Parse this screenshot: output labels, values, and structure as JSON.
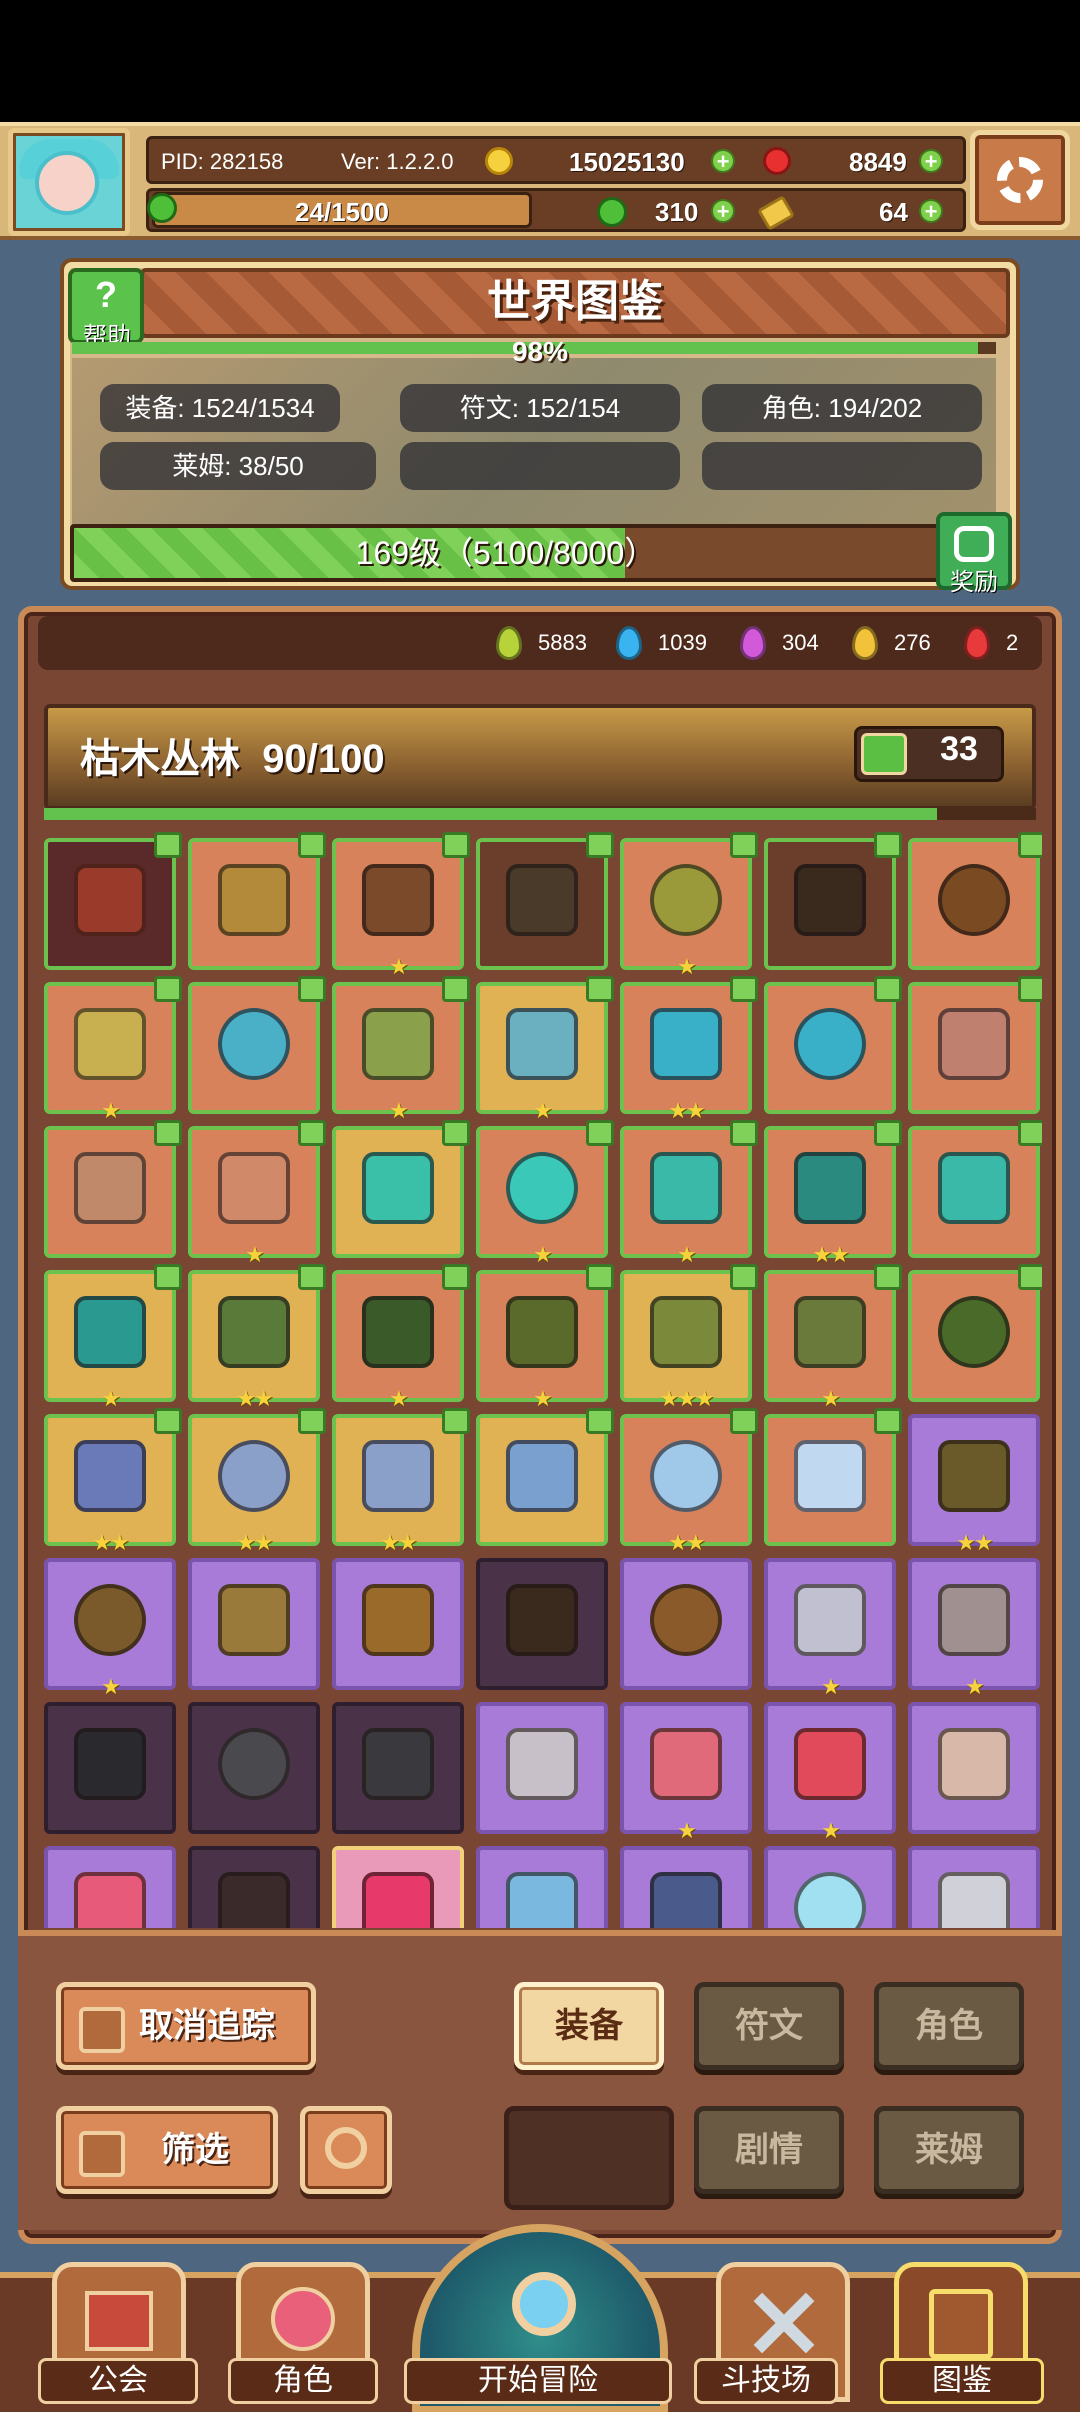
{
  "header": {
    "pid": "PID: 282158",
    "version": "Ver: 1.2.2.0",
    "gold": "15025130",
    "rubies": "8849",
    "stamina": "24/1500",
    "clovers": "310",
    "keys": "64"
  },
  "codex": {
    "title": "世界图鉴",
    "help_label": "帮助",
    "percent_label": "98%",
    "percent_value": 0.98,
    "stats": [
      "装备: 1524/1534",
      "符文: 152/154",
      "角色: 194/202",
      "莱姆: 38/50"
    ],
    "level_label": "169级（5100/8000）",
    "level_progress": 0.6375,
    "reward_label": "奖励"
  },
  "gems": [
    {
      "color": "#b8d23a",
      "count": "5883"
    },
    {
      "color": "#3ab4f0",
      "count": "1039"
    },
    {
      "color": "#d25ad8",
      "count": "304"
    },
    {
      "color": "#f2c23a",
      "count": "276"
    },
    {
      "color": "#e83a3a",
      "count": "2"
    }
  ],
  "area": {
    "name": "枯木丛林",
    "progress_label": "90/100",
    "progress_value": 0.9,
    "likes": "33"
  },
  "grid": [
    [
      {
        "bg": "maroon",
        "icon": "axe-icon",
        "color": "#9a3a2a",
        "stars": ""
      },
      {
        "bg": "orange",
        "icon": "wand-icon",
        "color": "#b38a3a",
        "stars": ""
      },
      {
        "bg": "orange",
        "icon": "boots-icon",
        "color": "#7a4a2a",
        "stars": "★"
      },
      {
        "bg": "brown",
        "icon": "armor-icon",
        "color": "#4a3a2a",
        "stars": ""
      },
      {
        "bg": "orange",
        "icon": "orb-icon",
        "color": "#9a9a3a",
        "stars": "★"
      },
      {
        "bg": "brown",
        "icon": "necklace-icon",
        "color": "#3a2a1e",
        "stars": ""
      },
      {
        "bg": "orange",
        "icon": "ring-icon",
        "color": "#7a4a22",
        "stars": ""
      }
    ],
    [
      {
        "bg": "orange",
        "icon": "crown-icon",
        "color": "#c8b050",
        "stars": "★"
      },
      {
        "bg": "orange",
        "icon": "ring-icon",
        "color": "#4ab0c8",
        "stars": ""
      },
      {
        "bg": "orange",
        "icon": "boots-icon",
        "color": "#8aa04a",
        "stars": "★"
      },
      {
        "bg": "gold",
        "icon": "armor-icon",
        "color": "#6ab0c0",
        "stars": "★"
      },
      {
        "bg": "orange",
        "icon": "glove-icon",
        "color": "#3ab0c8",
        "stars": "★★"
      },
      {
        "bg": "orange",
        "icon": "ring-icon",
        "color": "#3ab0c8",
        "stars": ""
      },
      {
        "bg": "orange",
        "icon": "glove-icon",
        "color": "#c08070",
        "stars": ""
      }
    ],
    [
      {
        "bg": "orange",
        "icon": "boots-icon",
        "color": "#c08a6a",
        "stars": ""
      },
      {
        "bg": "orange",
        "icon": "necklace-icon",
        "color": "#d08a6a",
        "stars": "★"
      },
      {
        "bg": "gold",
        "icon": "sword-icon",
        "color": "#3ac0a8",
        "stars": ""
      },
      {
        "bg": "orange",
        "icon": "orb-icon",
        "color": "#3ac8b8",
        "stars": "★"
      },
      {
        "bg": "orange",
        "icon": "glove-icon",
        "color": "#3ab8a8",
        "stars": "★"
      },
      {
        "bg": "orange",
        "icon": "helmet-icon",
        "color": "#2a8a80",
        "stars": "★★"
      },
      {
        "bg": "orange",
        "icon": "armor-icon",
        "color": "#3ab8a8",
        "stars": ""
      }
    ],
    [
      {
        "bg": "gold",
        "icon": "boots-icon",
        "color": "#2a9a90",
        "stars": "★"
      },
      {
        "bg": "gold",
        "icon": "necklace-icon",
        "color": "#5a7a3a",
        "stars": "★★"
      },
      {
        "bg": "orange",
        "icon": "armor-icon",
        "color": "#3a5a2a",
        "stars": "★"
      },
      {
        "bg": "orange",
        "icon": "amulet-icon",
        "color": "#5a6a2a",
        "stars": "★"
      },
      {
        "bg": "gold",
        "icon": "crown-icon",
        "color": "#7a8a3a",
        "stars": "★★★"
      },
      {
        "bg": "orange",
        "icon": "necklace-icon",
        "color": "#6a7a3a",
        "stars": "★"
      },
      {
        "bg": "orange",
        "icon": "ring-icon",
        "color": "#4a6a2a",
        "stars": ""
      }
    ],
    [
      {
        "bg": "gold",
        "icon": "helmet-icon",
        "color": "#6a7ab8",
        "stars": "★★"
      },
      {
        "bg": "gold",
        "icon": "ring-icon",
        "color": "#8aa0c8",
        "stars": "★★"
      },
      {
        "bg": "gold",
        "icon": "necklace-icon",
        "color": "#8aa0c8",
        "stars": "★★"
      },
      {
        "bg": "gold",
        "icon": "wand-icon",
        "color": "#7aa0d0",
        "stars": ""
      },
      {
        "bg": "orange",
        "icon": "orb-icon",
        "color": "#a0c8e8",
        "stars": "★★"
      },
      {
        "bg": "orange",
        "icon": "armor-icon",
        "color": "#c0d8f0",
        "stars": ""
      },
      {
        "bg": "purple",
        "icon": "necklace-icon",
        "color": "#6a5a2a",
        "stars": "★★"
      }
    ],
    [
      {
        "bg": "purple",
        "icon": "ring-icon",
        "color": "#7a5a2a",
        "stars": "★"
      },
      {
        "bg": "purple",
        "icon": "amulet-icon",
        "color": "#9a7a3a",
        "stars": ""
      },
      {
        "bg": "purple",
        "icon": "wand-icon",
        "color": "#9a6a2a",
        "stars": ""
      },
      {
        "bg": "dark",
        "icon": "boots-icon",
        "color": "#3a2a1e",
        "stars": ""
      },
      {
        "bg": "purple",
        "icon": "ring-icon",
        "color": "#8a5a2a",
        "stars": ""
      },
      {
        "bg": "purple",
        "icon": "sword-icon",
        "color": "#c0c0d0",
        "stars": "★"
      },
      {
        "bg": "purple",
        "icon": "glove-icon",
        "color": "#a09090",
        "stars": "★"
      }
    ],
    [
      {
        "bg": "dark",
        "icon": "helmet-icon",
        "color": "#2a2a2e",
        "stars": ""
      },
      {
        "bg": "dark",
        "icon": "orb-icon",
        "color": "#4a4a4e",
        "stars": ""
      },
      {
        "bg": "dark",
        "icon": "helmet-icon",
        "color": "#3a3a3e",
        "stars": ""
      },
      {
        "bg": "purple",
        "icon": "armor-icon",
        "color": "#c8c0c8",
        "stars": ""
      },
      {
        "bg": "purple",
        "icon": "wand-icon",
        "color": "#e06a7a",
        "stars": "★"
      },
      {
        "bg": "purple",
        "icon": "gem-icon",
        "color": "#e04a5a",
        "stars": "★"
      },
      {
        "bg": "purple",
        "icon": "armor-icon",
        "color": "#d8b8a8",
        "stars": ""
      }
    ],
    [
      {
        "bg": "purple",
        "icon": "gem-icon",
        "color": "#e85a7a",
        "stars": ""
      },
      {
        "bg": "dark",
        "icon": "necklace-icon",
        "color": "#3a2a2a",
        "stars": ""
      },
      {
        "bg": "pink",
        "icon": "gem-icon",
        "color": "#e83a6a",
        "stars": ""
      },
      {
        "bg": "purple",
        "icon": "wand-icon",
        "color": "#7ab8e0",
        "stars": ""
      },
      {
        "bg": "purple",
        "icon": "wand-icon",
        "color": "#4a5a8a",
        "stars": ""
      },
      {
        "bg": "purple",
        "icon": "orb-icon",
        "color": "#a0e0f0",
        "stars": ""
      },
      {
        "bg": "purple",
        "icon": "armor-icon",
        "color": "#d0d0d8",
        "stars": ""
      }
    ]
  ],
  "controls": {
    "untrack": "取消追踪",
    "filter": "筛选",
    "tab_equipment": "装备",
    "tab_runes": "符文",
    "tab_characters": "角色",
    "tab_story": "剧情",
    "tab_slime": "莱姆"
  },
  "nav": {
    "guild": "公会",
    "characters": "角色",
    "start": "开始冒险",
    "arena": "斗技场",
    "codex": "图鉴"
  }
}
